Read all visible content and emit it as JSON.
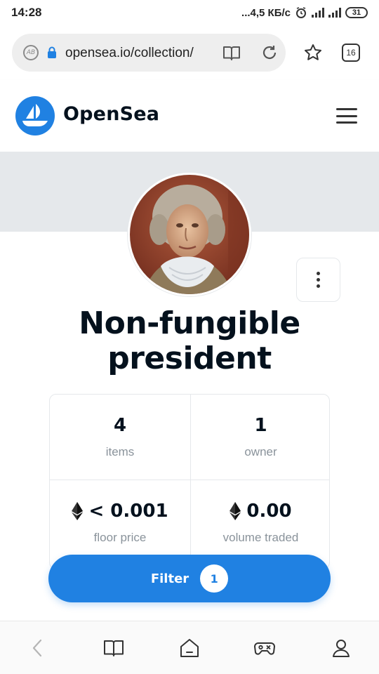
{
  "status_bar": {
    "time": "14:28",
    "network_speed": "...4,5 КБ/с",
    "battery": "31"
  },
  "browser": {
    "url": "opensea.io/collection/",
    "tab_count": "16",
    "adblock_label": "AB"
  },
  "header": {
    "brand": "OpenSea",
    "logo_color": "#2081e2"
  },
  "collection": {
    "title": "Non-fungible president",
    "stats": [
      {
        "value": "4",
        "label": "items",
        "eth": false
      },
      {
        "value": "1",
        "label": "owner",
        "eth": false
      },
      {
        "value": "< 0.001",
        "label": "floor price",
        "eth": true
      },
      {
        "value": "0.00",
        "label": "volume traded",
        "eth": true
      }
    ]
  },
  "filter": {
    "label": "Filter",
    "count": "1",
    "color": "#2081e2"
  },
  "bottom_nav": {
    "icons": [
      "back-icon",
      "bookmarks-icon",
      "home-icon",
      "games-icon",
      "profile-icon"
    ]
  }
}
